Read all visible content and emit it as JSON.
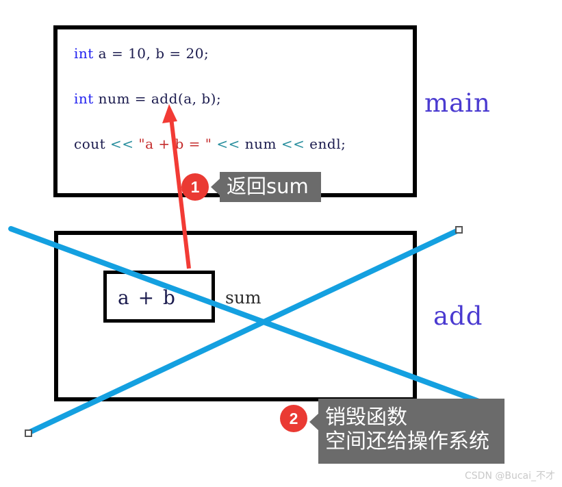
{
  "diagram": {
    "title_labels": {
      "main": "main",
      "add": "add"
    },
    "code": {
      "line1": {
        "kw": "int",
        "rest": " a = 10, b = 20;"
      },
      "line2": {
        "kw": "int",
        "rest": " num = add(a, b);"
      },
      "line3": {
        "cout": "cout ",
        "op1": "<<",
        "str": " \"a + b = \" ",
        "op2": "<<",
        "num": " num ",
        "op3": "<<",
        "endl": " endl;"
      }
    },
    "add_body": {
      "expression": "a + b",
      "return_label": "sum"
    },
    "callouts": [
      {
        "number": "1",
        "text": "返回sum"
      },
      {
        "number": "2",
        "line1": "销毁函数",
        "line2": "空间还给操作系统"
      }
    ],
    "annotations": {
      "red_arrow_name": "return-flow-arrow",
      "cross_out_name": "destroy-cross-lines"
    },
    "colors": {
      "keyword": "#2020f0",
      "stream_operator": "#2a8f9e",
      "string_literal": "#c42b2b",
      "function_label": "#4a3ad0",
      "badge_red": "#ea3a33",
      "bubble_gray": "#6b6b6b",
      "cross_blue": "#14a0e0",
      "arrow_red": "#f23b35",
      "frame_black": "#000000"
    },
    "watermark": "CSDN @Bucai_不才"
  }
}
